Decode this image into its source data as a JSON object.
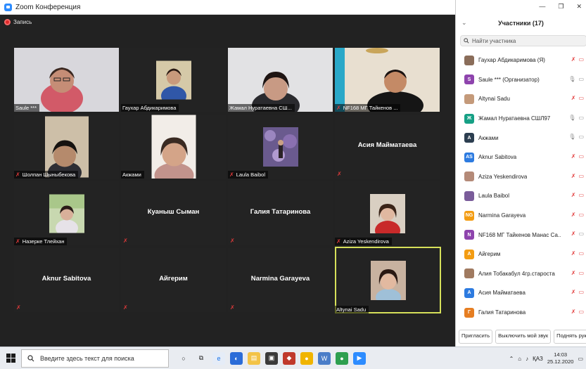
{
  "window": {
    "title": "Zoom Конференция"
  },
  "recording": {
    "label": "Запись"
  },
  "tiles": [
    {
      "name": "Saule ***",
      "video": true,
      "muted": false
    },
    {
      "name": "Гаухар Абдикаримова",
      "video": true,
      "muted": false
    },
    {
      "name": "Жамал Нуратаевна СШ...",
      "video": true,
      "muted": false
    },
    {
      "name": "NF168 МГ Тайкенов ...",
      "video": true,
      "muted": true
    },
    {
      "name": "Шолпан Шыныбекова",
      "video": true,
      "muted": true
    },
    {
      "name": "Акжами",
      "video": true,
      "muted": false
    },
    {
      "name": "Laula Baibol",
      "video": true,
      "muted": true
    },
    {
      "name": "Асия Майматаева",
      "video": false,
      "muted": true
    },
    {
      "name": "Назерке Тлейхан",
      "video": true,
      "muted": true
    },
    {
      "name": "Куаныш Сыман",
      "video": false,
      "muted": true
    },
    {
      "name": "Галия Татаринова",
      "video": false,
      "muted": true
    },
    {
      "name": "Aziza Yeskendirova",
      "video": true,
      "muted": true
    },
    {
      "name": "Aknur Sabitova",
      "video": false,
      "muted": true
    },
    {
      "name": "Айгерим",
      "video": false,
      "muted": true
    },
    {
      "name": "Narmina Garayeva",
      "video": false,
      "muted": true
    },
    {
      "name": "Altynai Sadu",
      "video": true,
      "muted": false,
      "active": true
    }
  ],
  "panel": {
    "title": "Участники (17)",
    "search_placeholder": "Найти участника",
    "participants": [
      {
        "name": "Гаухар Абдикаримова (Я)",
        "avatar": "photo",
        "color": "#8a6d5a",
        "mic": "off",
        "video": "off"
      },
      {
        "name": "Saule *** (Организатор)",
        "avatar": "S",
        "color": "#8e44ad",
        "mic": "on",
        "video": "on"
      },
      {
        "name": "Altynai Sadu",
        "avatar": "photo",
        "color": "#c49a7a",
        "mic": "off",
        "video": "off"
      },
      {
        "name": "Жамал Нуратаевна СШЛ97",
        "avatar": "Ж",
        "color": "#16a085",
        "mic": "on",
        "video": "on"
      },
      {
        "name": "Акжами",
        "avatar": "A",
        "color": "#2c3e50",
        "mic": "on",
        "video": "on"
      },
      {
        "name": "Aknur Sabitova",
        "avatar": "AS",
        "color": "#2d7be0",
        "mic": "off",
        "video": "off"
      },
      {
        "name": "Aziza Yeskendirova",
        "avatar": "photo",
        "color": "#b48a78",
        "mic": "off",
        "video": "off"
      },
      {
        "name": "Laula Baibol",
        "avatar": "photo",
        "color": "#7a5c9a",
        "mic": "off",
        "video": "off"
      },
      {
        "name": "Narmina Garayeva",
        "avatar": "NG",
        "color": "#f39c12",
        "mic": "off",
        "video": "off"
      },
      {
        "name": "NF168 МГ Тайкенов Манас Са...",
        "avatar": "N",
        "color": "#8e44ad",
        "mic": "off",
        "video": "on"
      },
      {
        "name": "Айгерим",
        "avatar": "A",
        "color": "#f39c12",
        "mic": "off",
        "video": "off"
      },
      {
        "name": "Алия Тобакабул 4гр.староста",
        "avatar": "photo",
        "color": "#a07a60",
        "mic": "off",
        "video": "off"
      },
      {
        "name": "Асия Майматаева",
        "avatar": "A",
        "color": "#2d7be0",
        "mic": "off",
        "video": "off"
      },
      {
        "name": "Галия Татаринова",
        "avatar": "Г",
        "color": "#e67e22",
        "mic": "off",
        "video": "off"
      }
    ],
    "footer": {
      "invite": "Пригласить",
      "mute_me": "Выключить мой звук",
      "raise": "Поднять руку"
    }
  },
  "taskbar": {
    "search_placeholder": "Введите здесь текст для поиска",
    "lang": "ҚАЗ",
    "time": "14:03",
    "date": "25.12.2020"
  }
}
